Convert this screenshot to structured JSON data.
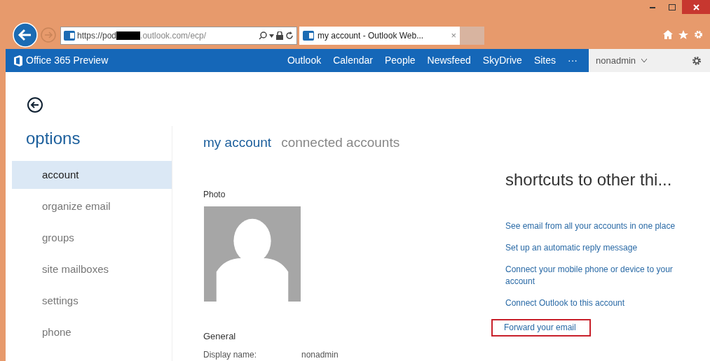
{
  "browser": {
    "url_start": "https://pod",
    "url_end": ".outlook.com/ecp/",
    "tabs": [
      {
        "title": "my account - Outlook Web...",
        "close": "×",
        "selected": true
      }
    ]
  },
  "app_bar": {
    "title": "Office 365 Preview",
    "nav": [
      {
        "label": "Outlook"
      },
      {
        "label": "Calendar"
      },
      {
        "label": "People"
      },
      {
        "label": "Newsfeed"
      },
      {
        "label": "SkyDrive"
      },
      {
        "label": "Sites"
      },
      {
        "label": "···"
      }
    ],
    "user": "nonadmin"
  },
  "sidebar": {
    "title": "options",
    "items": [
      {
        "label": "account",
        "selected": true
      },
      {
        "label": "organize email",
        "selected": false
      },
      {
        "label": "groups",
        "selected": false
      },
      {
        "label": "site mailboxes",
        "selected": false
      },
      {
        "label": "settings",
        "selected": false
      },
      {
        "label": "phone",
        "selected": false
      }
    ]
  },
  "main": {
    "tabs": [
      {
        "label": "my account",
        "selected": true
      },
      {
        "label": "connected accounts",
        "selected": false
      }
    ],
    "photo_label": "Photo",
    "general_label": "General",
    "fields": [
      {
        "label": "Display name:",
        "value": "nonadmin"
      }
    ]
  },
  "shortcuts": {
    "title": "shortcuts to other thi...",
    "links": [
      {
        "label": "See email from all your accounts in one place",
        "highlighted": false
      },
      {
        "label": "Set up an automatic reply message",
        "highlighted": false
      },
      {
        "label": "Connect your mobile phone or device to your account",
        "highlighted": false
      },
      {
        "label": "Connect Outlook to this account",
        "highlighted": false
      },
      {
        "label": "Forward your email",
        "highlighted": true
      }
    ]
  }
}
